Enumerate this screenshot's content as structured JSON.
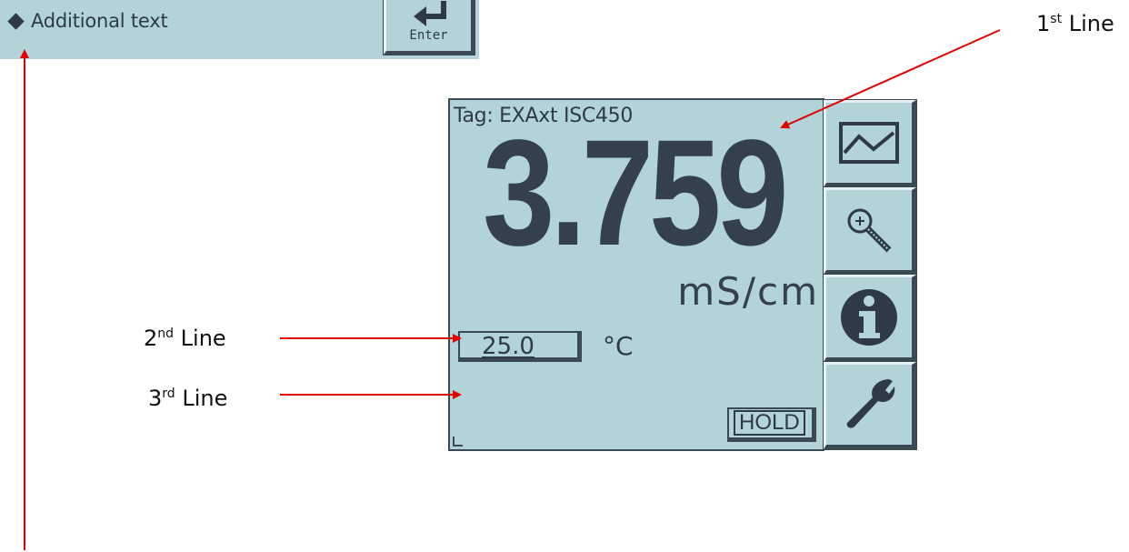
{
  "additional_text_bar": {
    "text": "Additional text",
    "enter_label": "Enter",
    "diamond_icon": "diamond-bullet-icon"
  },
  "display": {
    "tag": "Tag: EXAxt ISC450",
    "main_value": "3.759",
    "unit": "mS/cm",
    "temperature_value": "25.0",
    "temperature_unit": "°C",
    "hold_label": "HOLD"
  },
  "side_buttons": [
    {
      "icon": "trend-chart-icon"
    },
    {
      "icon": "zoom-magnifier-icon"
    },
    {
      "icon": "info-icon"
    },
    {
      "icon": "wrench-icon"
    }
  ],
  "annotations": {
    "line1": {
      "number": "1",
      "suffix": "st",
      "word": " Line"
    },
    "line2": {
      "number": "2",
      "suffix": "nd",
      "word": " Line"
    },
    "line3": {
      "number": "3",
      "suffix": "rd",
      "word": " Line"
    }
  },
  "colors": {
    "lcd_background": "#b2d3d8",
    "lcd_ink": "#34404c",
    "arrow": "#e00000"
  }
}
